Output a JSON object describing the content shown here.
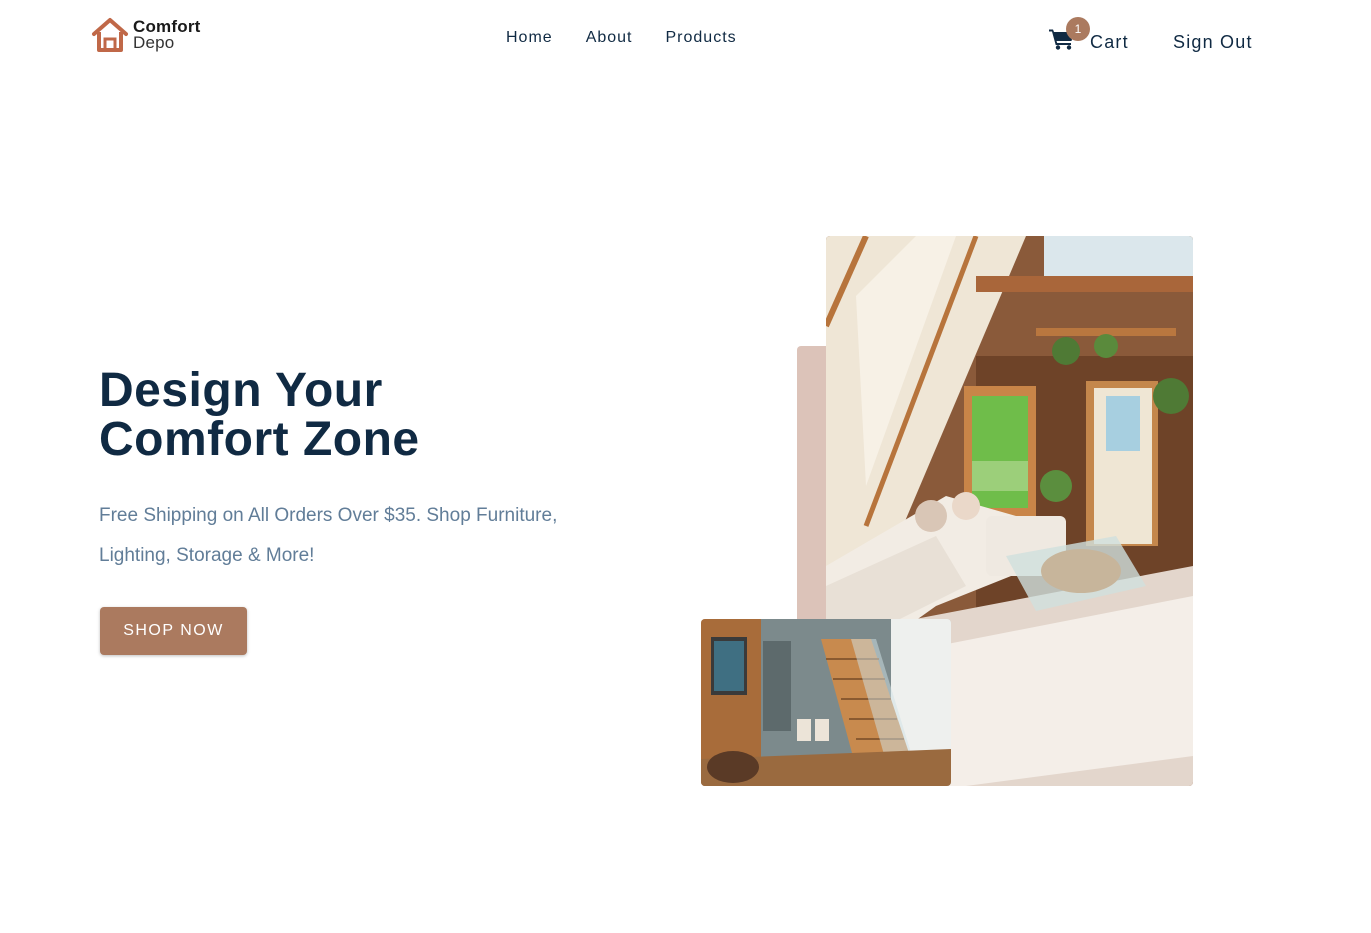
{
  "header": {
    "logo": {
      "line1": "Comfort",
      "line2": "Depo",
      "icon": "house-icon"
    },
    "nav": [
      {
        "label": "Home"
      },
      {
        "label": "About"
      },
      {
        "label": "Products"
      }
    ],
    "cart": {
      "label": "Cart",
      "count": "1",
      "icon": "cart-icon"
    },
    "signout_label": "Sign Out"
  },
  "hero": {
    "title_line1": "Design Your",
    "title_line2": "Comfort Zone",
    "subtitle": "Free Shipping on All Orders Over $35. Shop Furniture, Lighting, Storage & More!",
    "button_label": "SHOP NOW"
  },
  "colors": {
    "primary": "#ab7a5f",
    "accent_light": "#dcc3b9",
    "heading": "#102a43",
    "body_text": "#617d98"
  }
}
